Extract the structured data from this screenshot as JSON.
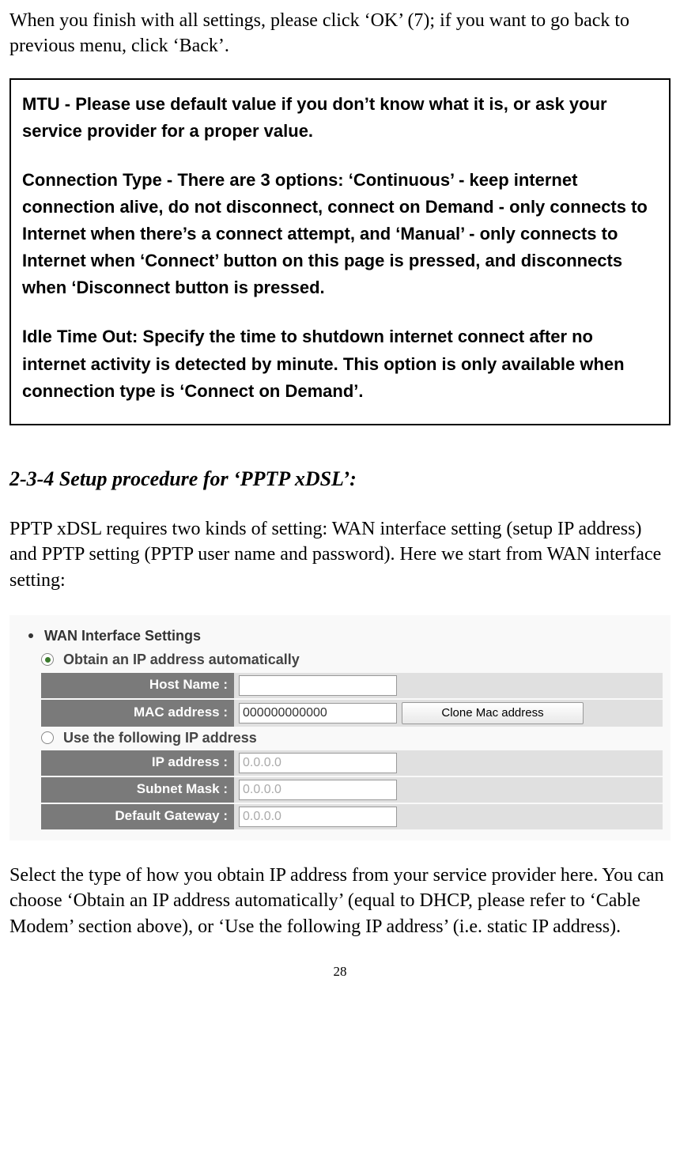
{
  "intro_text": "When you finish with all settings, please click ‘OK’ (7); if you want to go back to previous menu, click ‘Back’.",
  "info_box": {
    "mtu": "MTU - Please use default value if you don’t know what it is, or ask your service provider for a proper value.",
    "connection_type": "Connection Type - There are 3 options: ‘Continuous’ - keep internet connection alive, do not disconnect, connect on Demand - only connects to Internet when there’s a connect attempt, and ‘Manual’ - only connects to Internet when ‘Connect’ button on this page is pressed, and disconnects when ‘Disconnect button is pressed.",
    "idle_timeout": "Idle Time Out: Specify the time to shutdown internet connect after no internet activity is detected by minute. This option is only available when connection type is ‘Connect on Demand’."
  },
  "section_heading": "2-3-4 Setup procedure for ‘PPTP xDSL’:",
  "section_desc": "PPTP xDSL requires two kinds of setting: WAN interface setting (setup IP address) and PPTP setting (PPTP user name and password). Here we start from WAN interface setting:",
  "wan": {
    "title": "WAN Interface Settings",
    "obtain_auto_label": "Obtain an IP address automatically",
    "use_following_label": "Use the following IP address",
    "host_name_label": "Host Name :",
    "host_name_value": "",
    "mac_label": "MAC address :",
    "mac_value": "000000000000",
    "clone_button": "Clone Mac address",
    "ip_label": "IP address :",
    "ip_value": "0.0.0.0",
    "subnet_label": "Subnet Mask :",
    "subnet_value": "0.0.0.0",
    "gateway_label": "Default Gateway :",
    "gateway_value": "0.0.0.0"
  },
  "bottom_text": "Select the type of how you obtain IP address from your service provider here. You can choose ‘Obtain an IP address automatically’ (equal to DHCP, please refer to ‘Cable Modem’ section above), or ‘Use the following IP address’ (i.e. static IP address).",
  "page_number": "28"
}
